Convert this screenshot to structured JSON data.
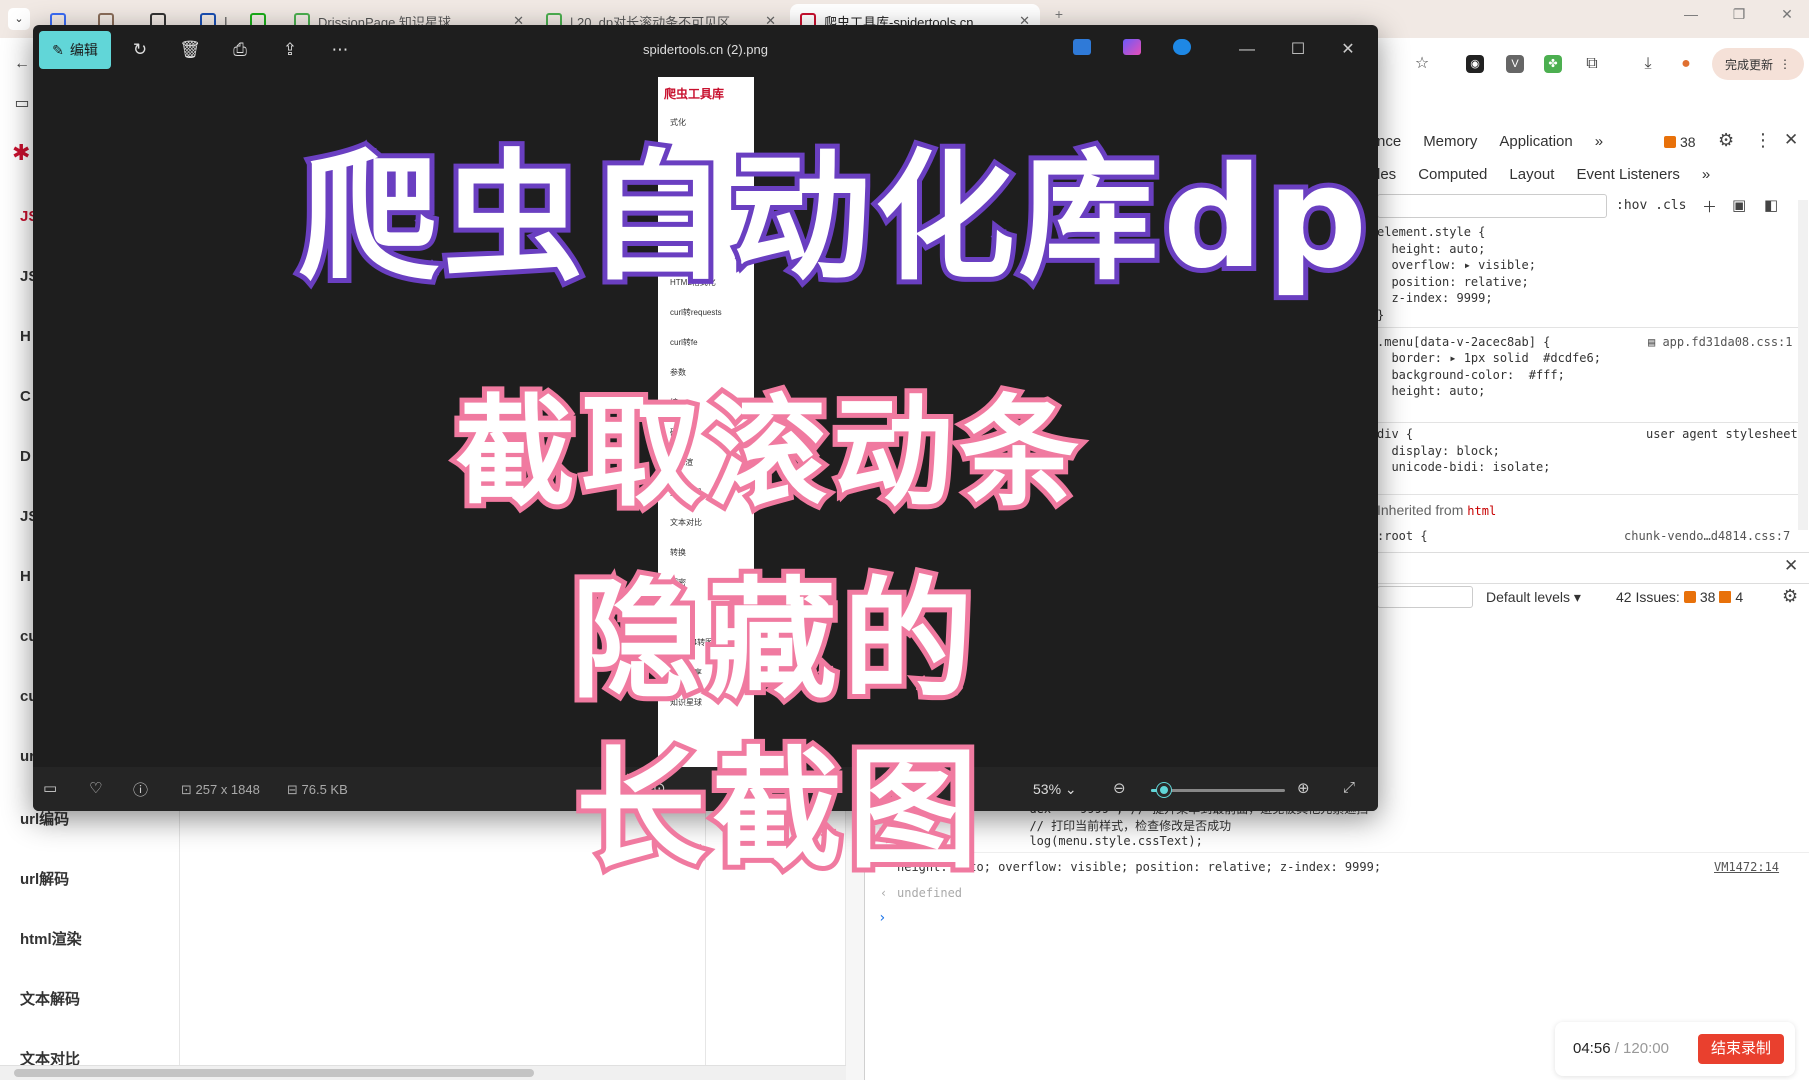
{
  "browser": {
    "tabs": [
      {
        "label": "",
        "color": "#3b6cf5"
      },
      {
        "label": "",
        "color": "#8a6d5a"
      },
      {
        "label": "",
        "color": "#333333"
      },
      {
        "label": "ISO",
        "color": "#1a4fb3"
      },
      {
        "label": "",
        "color": "#1aad19"
      },
      {
        "label": "DrissionPage 知识星球",
        "color": "#4caf50"
      },
      {
        "label": "| 20. dp对长滚动条不可见区",
        "color": "#4caf50"
      },
      {
        "label": "爬虫工具库-spidertools.cn",
        "color": "#c8102e"
      }
    ],
    "update_label": "完成更新",
    "accent": "#f5e1d8"
  },
  "page": {
    "nav_items": [
      "JS",
      "JS",
      "H",
      "C",
      "D",
      "JS",
      "H",
      "cu",
      "cu",
      "ur",
      "url编码",
      "url解码",
      "html渲染",
      "文本解码",
      "文本对比"
    ]
  },
  "devtools": {
    "tabs": [
      "nce",
      "Memory",
      "Application",
      "»"
    ],
    "issue_count": "38",
    "sub_tabs": [
      "les",
      "Computed",
      "Layout",
      "Event Listeners",
      "»"
    ],
    "hov_cls": ":hov  .cls",
    "css_lines": [
      "element.style {",
      "  height: auto;",
      "  overflow: ▸ visible;",
      "  position: relative;",
      "  z-index: 9999;",
      "}"
    ],
    "rule2_selector": ".menu[data-v-2acec8ab] {",
    "rule2_source": "app.fd31da08.css:1",
    "rule2_lines": [
      "  border: ▸ 1px solid  #dcdfe6;",
      "  background-color:  #fff;",
      "  height: auto;"
    ],
    "ua_label": "user agent stylesheet",
    "ua_lines": [
      "div {",
      "  display: block;",
      "  unicode-bidi: isolate;"
    ],
    "inherited_label": "Inherited from",
    "inherited_tag": "html",
    "root_line": ":root {",
    "root_source": "chunk-vendo…d4814.css:7",
    "levels": "Default levels ▾",
    "issues_text": "42 Issues:",
    "issues_a": "38",
    "issues_b": "4",
    "console_lines": [
      "  dex = '9999'; // 提升菜单到最前面，避免被其他元素遮挡",
      "  // 打印当前样式，检查修改是否成功",
      "  log(menu.style.cssText);"
    ],
    "console_result": "height: auto; overflow: visible; position: relative; z-index: 9999;",
    "vm_link": "VM1472:14",
    "undefined_text": "undefined",
    "prompt": "›"
  },
  "recorder": {
    "elapsed": "04:56",
    "total": " / 120:00",
    "stop_label": "结束录制"
  },
  "viewer": {
    "edit_label": "编辑",
    "title": "spidertools.cn  (2).png",
    "dimensions": "257 x 1848",
    "file_size": "76.5 KB",
    "zoom": "53%",
    "zoom_fraction": 0.1,
    "strip_logo": "爬虫工具库",
    "strip_items": [
      "式化",
      "HTML格式化",
      "curl转requests",
      "curl转fe",
      "参数",
      "编",
      "码",
      "html渲",
      "文本解码",
      "文本对比",
      "转换",
      "解密",
      "N",
      "Base64转图片",
      "代码分享",
      "知识星球"
    ]
  },
  "captions": {
    "line1": "爬虫自动化库dp",
    "line2": "截取滚动条",
    "line3": "隐藏的",
    "line4": "长截图"
  }
}
